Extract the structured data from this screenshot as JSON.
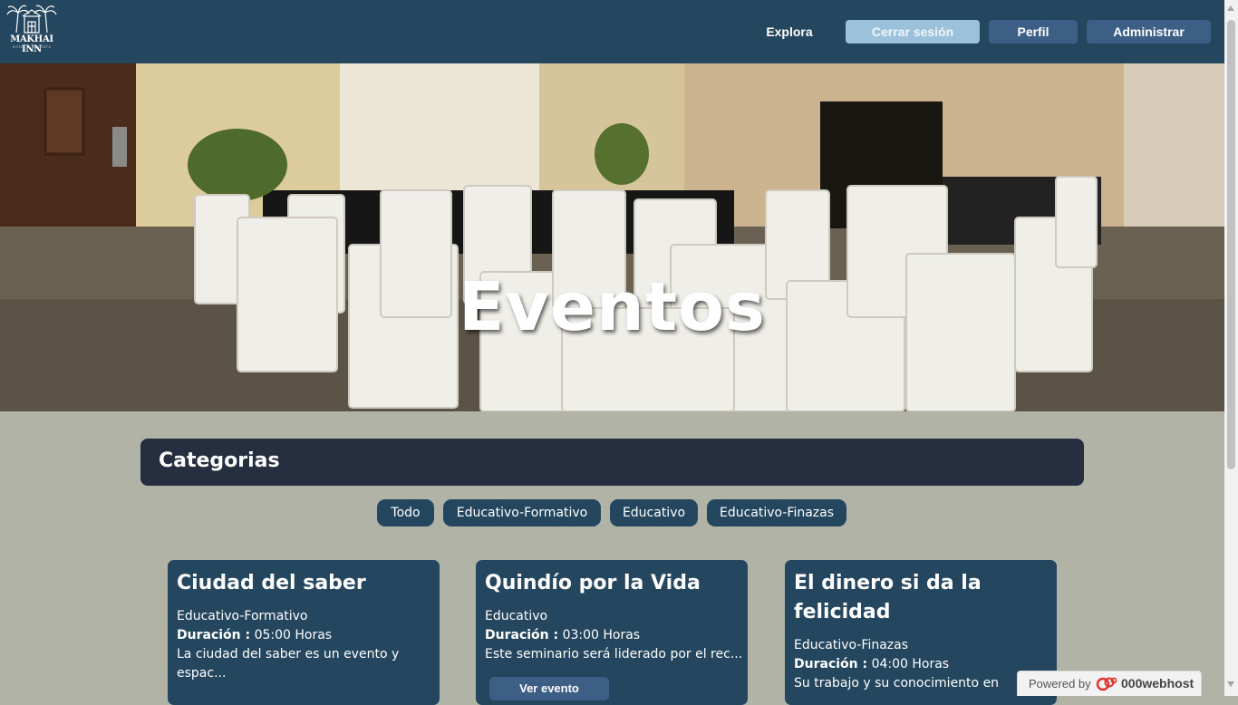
{
  "header": {
    "logo": {
      "name": "MAKHAI INN",
      "tagline": "HOTEL & RESORTS",
      "icon": "palm-hotel-logo"
    },
    "nav": {
      "explore": "Explora",
      "logout": "Cerrar sesión",
      "profile": "Perfil",
      "admin": "Administrar"
    }
  },
  "hero": {
    "title": "Eventos"
  },
  "categories": {
    "title": "Categorias",
    "chips": [
      "Todo",
      "Educativo-Formativo",
      "Educativo",
      "Educativo-Finazas"
    ]
  },
  "events": [
    {
      "title": "Ciudad del saber",
      "category": "Educativo-Formativo",
      "duration_label": "Duración :",
      "duration": "05:00 Horas",
      "description": "La ciudad del saber es un evento y espac..."
    },
    {
      "title": "Quindío por la Vida",
      "category": "Educativo",
      "duration_label": "Duración :",
      "duration": "03:00 Horas",
      "description": "Este seminario será liderado por el rec...",
      "button": "Ver evento"
    },
    {
      "title": "El dinero si da la felicidad",
      "category": "Educativo-Finazas",
      "duration_label": "Duración :",
      "duration": "04:00 Horas",
      "description": "Su trabajo y su conocimiento en"
    }
  ],
  "badge": {
    "prefix": "Powered by",
    "brand": "000webhost",
    "icon": "000webhost-logo-icon"
  },
  "colors": {
    "header_bg": "#24465e",
    "page_bg": "#b0b3a6",
    "category_bar_bg": "#252f40",
    "card_bg": "#24465e",
    "button_bg": "#3d5f86",
    "logout_bg": "#9cc2db"
  }
}
